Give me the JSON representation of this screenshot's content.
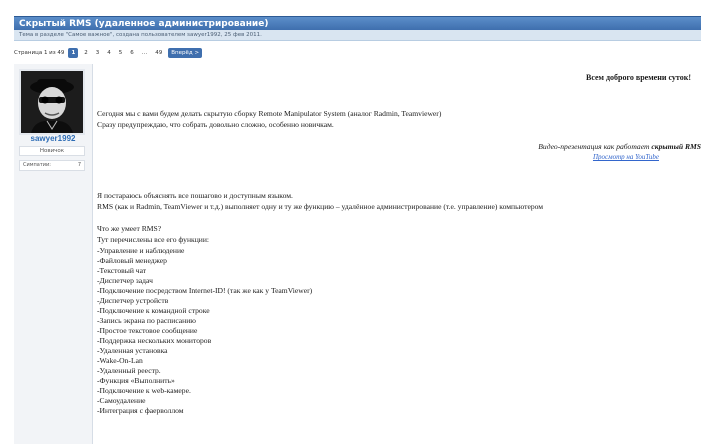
{
  "thread": {
    "title": "Скрытый RMS (удаленное администрирование)",
    "subtitle": "Тема в разделе \"Самое важное\", создана пользователем sawyer1992, 25 фев 2011."
  },
  "pagination": {
    "label": "Страница 1 из 49",
    "pages": [
      "1",
      "2",
      "3",
      "4",
      "5",
      "6",
      "…",
      "49"
    ],
    "current": "1",
    "next_label": "Вперёд >"
  },
  "author": {
    "username": "sawyer1992",
    "rank": "Новичок",
    "likes_label": "Симпатии:",
    "likes_value": "7",
    "avatar_icon": "avatar-portrait-icon"
  },
  "post": {
    "greeting": "Всем доброго времени суток!",
    "intro": [
      "Сегодня мы с вами будем делать скрытую сборку Remote Manipulator System (аналог Radmin, Teamviewer)",
      "Сразу предупреждаю, что собрать довольно сложно, особенно новичкам."
    ],
    "video_prefix": "Видео-презентация как работает",
    "video_bold": "скрытый RMS",
    "video_link": "Просмотр на YouTube",
    "explain": [
      "Я постараюсь объяснять все пошагово и доступным языком.",
      "RMS (как и Radmin, TeamViewer и т.д.) выполняет одну и ту же функцию – удалённое администрирование (т.е. управление) компьютером"
    ],
    "features_heading": "Что же умеет RMS?",
    "features_intro": "Тут перечислены все его функции:",
    "features": [
      "-Управление и наблюдение",
      "-Файловый менеджер",
      "-Текстовый чат",
      "-Диспетчер задач",
      "-Подключение посредством Internet-ID! (так же как у TeamViewer)",
      "-Диспетчер устройств",
      "-Подключение к командной строке",
      "-Запись экрана по расписанию",
      "-Простое текстовое сообщение",
      "-Поддержка нескольких мониторов",
      "-Удаленная установка",
      "-Wake-On-Lan",
      "-Удаленный реестр.",
      "-Функция «Выполнить»",
      "-Подключение к web-камере.",
      "-Самоудаление",
      "-Интеграция с фаерволлом"
    ]
  },
  "colors": {
    "title_bar": "#3f6fae",
    "link": "#3366cc",
    "username": "#2d6cb5"
  }
}
